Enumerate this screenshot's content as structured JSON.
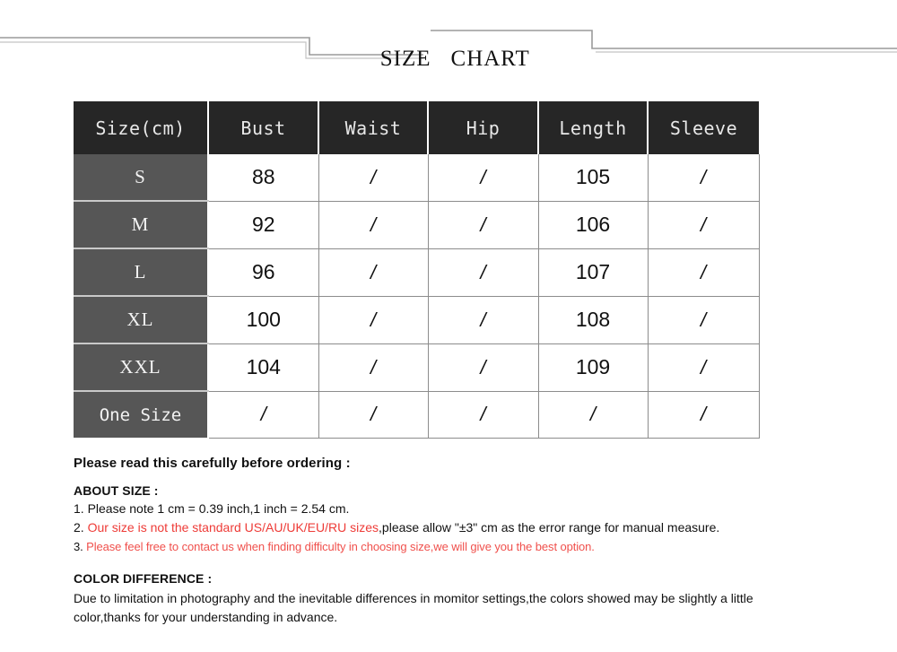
{
  "title": {
    "word1": "SIZE",
    "word2": "CHART"
  },
  "table": {
    "columns": [
      "Size(cm)",
      "Bust",
      "Waist",
      "Hip",
      "Length",
      "Sleeve"
    ],
    "rows": [
      {
        "size": "S",
        "mono": false,
        "values": [
          "88",
          "/",
          "/",
          "105",
          "/"
        ]
      },
      {
        "size": "M",
        "mono": false,
        "values": [
          "92",
          "/",
          "/",
          "106",
          "/"
        ]
      },
      {
        "size": "L",
        "mono": false,
        "values": [
          "96",
          "/",
          "/",
          "107",
          "/"
        ]
      },
      {
        "size": "XL",
        "mono": false,
        "values": [
          "100",
          "/",
          "/",
          "108",
          "/"
        ]
      },
      {
        "size": "XXL",
        "mono": false,
        "values": [
          "104",
          "/",
          "/",
          "109",
          "/"
        ]
      },
      {
        "size": "One Size",
        "mono": true,
        "values": [
          "/",
          "/",
          "/",
          "/",
          "/"
        ]
      }
    ]
  },
  "notes": {
    "heading": "Please read this carefully before ordering :",
    "about_size_heading": "ABOUT SIZE :",
    "line1": "1. Please note 1 cm = 0.39 inch,1 inch = 2.54 cm.",
    "line2_number": "2.",
    "line2_red": " Our size is not the standard US/AU/UK/EU/RU sizes",
    "line2_black": ",please allow \"±3\" cm as the error range for manual measure.",
    "line3_number": "3.",
    "line3_red": " Please feel free to contact us when finding difficulty in choosing size,we will give you the best option.",
    "color_difference_heading": "COLOR DIFFERENCE :",
    "color_difference_body": "Due to limitation in photography and the inevitable differences in momitor settings,the colors showed may be slightly a little color,thanks for your understanding in advance."
  },
  "colors": {
    "header_bg": "#262626",
    "size_cell_bg": "#565656",
    "red_text": "#ee3b37",
    "grid_line": "#8c8c8c",
    "rule_line": "#9a9a9a"
  }
}
